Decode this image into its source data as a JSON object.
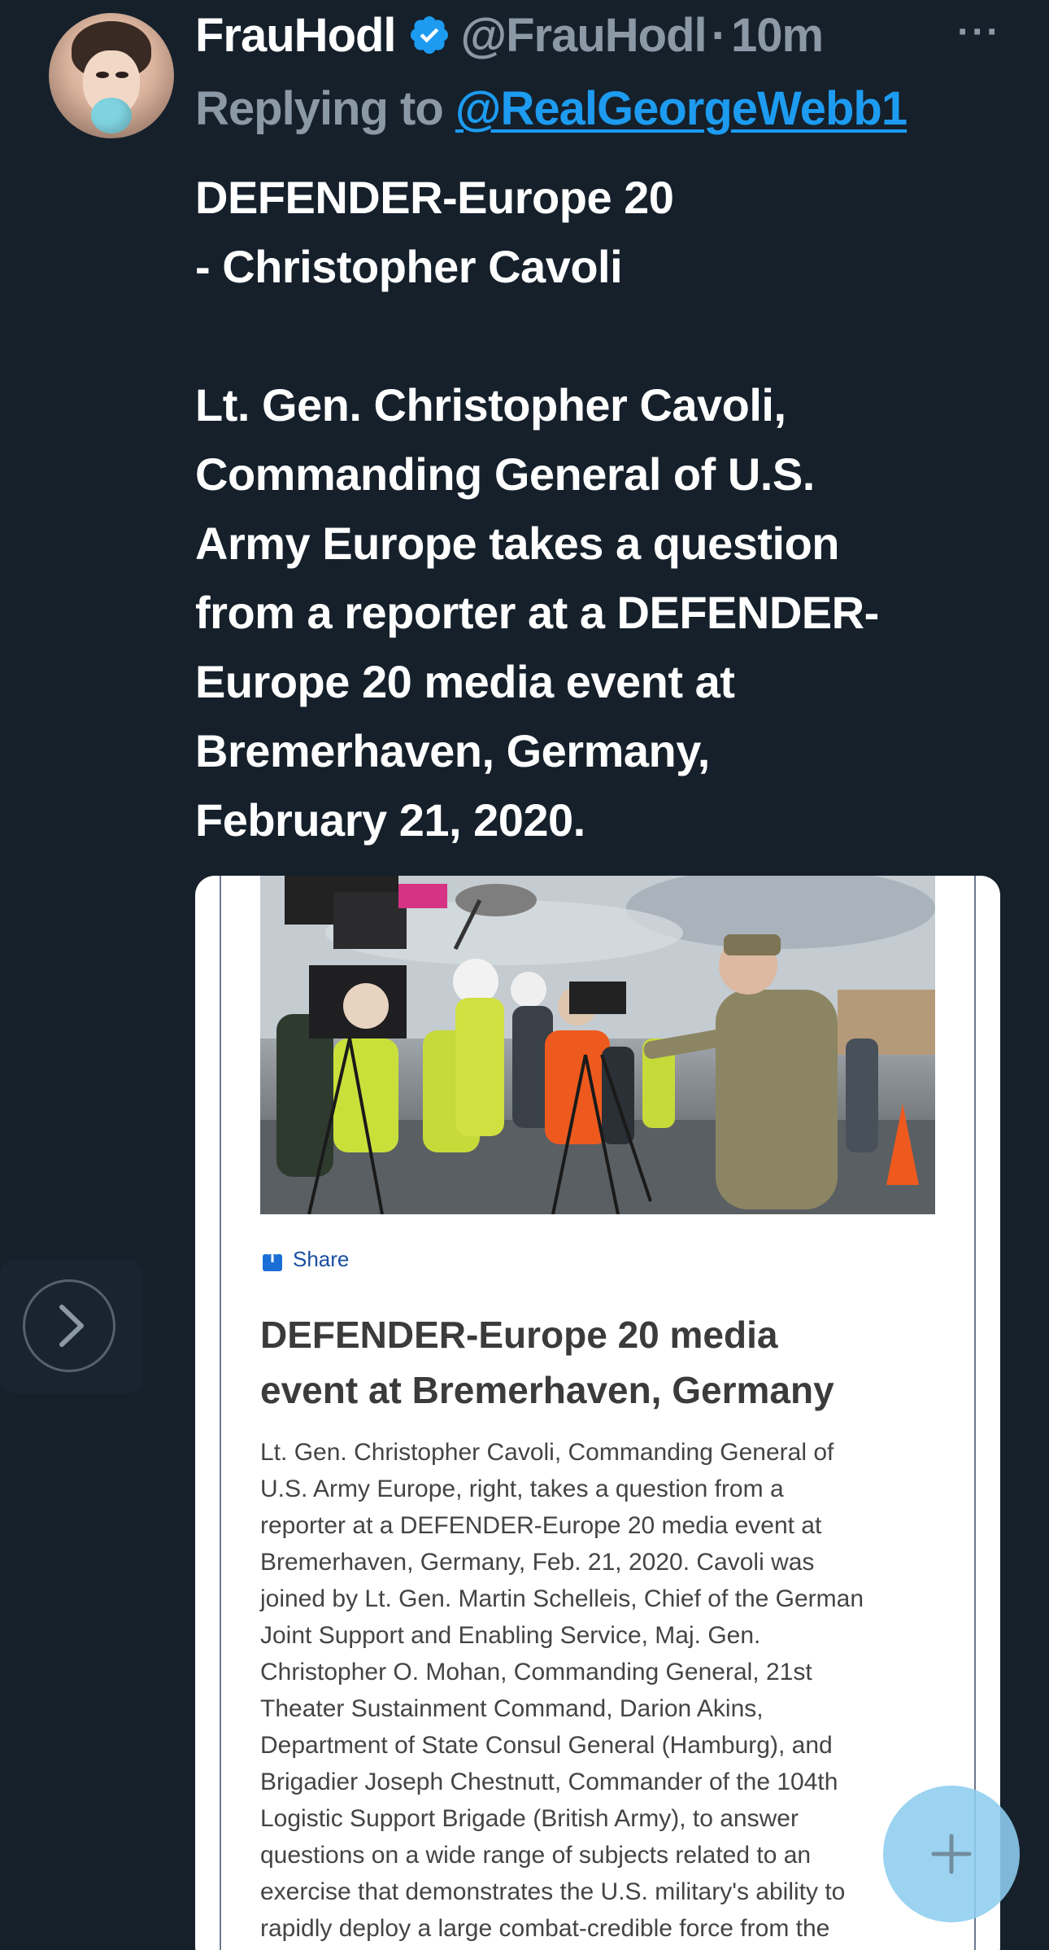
{
  "tweet": {
    "display_name": "FrauHodl",
    "handle": "@FrauHodl",
    "separator": "·",
    "time": "10m",
    "more_label": "···",
    "replying_label": "Replying to",
    "replying_to": "@RealGeorgeWebb1",
    "text_lines": [
      "DEFENDER-Europe 20",
      "- Christopher Cavoli",
      "",
      "Lt. Gen. Christopher Cavoli,",
      "Commanding General of U.S.",
      "Army Europe takes a question",
      "from a reporter at a DEFENDER-",
      "Europe 20 media event at",
      "Bremerhaven, Germany,",
      "February 21, 2020."
    ]
  },
  "media": {
    "share_label": "Share",
    "title_lines": [
      "DEFENDER-Europe 20 media",
      "event at Bremerhaven, Germany"
    ],
    "body_lines": [
      "Lt. Gen. Christopher Cavoli, Commanding General of",
      "U.S. Army Europe, right, takes a question from a",
      "reporter at a DEFENDER-Europe 20 media event at",
      "Bremerhaven, Germany, Feb. 21, 2020. Cavoli was",
      "joined by Lt. Gen. Martin Schelleis, Chief of the German",
      "Joint Support and Enabling Service, Maj. Gen.",
      "Christopher O. Mohan, Commanding General, 21st",
      "Theater Sustainment Command, Darion Akins,",
      "Department of State Consul General (Hamburg), and",
      "Brigadier Joseph Chestnutt, Commander of the 104th",
      "Logistic Support Brigade (British Army), to answer",
      "questions on a wide range of subjects related to an",
      "exercise that demonstrates the U.S. military's ability to",
      "rapidly deploy a large combat-credible force from the"
    ]
  },
  "icons": {
    "verified": "verified-badge-icon",
    "more": "more-horizontal-icon",
    "share": "share-icon",
    "next": "chevron-right-icon",
    "compose": "plus-icon"
  },
  "colors": {
    "background": "#15202b",
    "text_primary": "#ffffff",
    "text_secondary": "#8b98a5",
    "accent": "#1d9bf0",
    "fab": "#8ecdf0"
  }
}
